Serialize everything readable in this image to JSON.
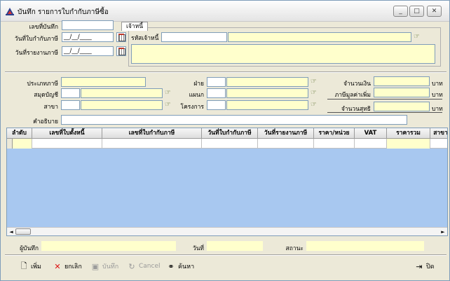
{
  "window": {
    "title": "บันทึก รายการใบกำกับภาษีซื้อ",
    "min": "_",
    "max": "□",
    "close": "✕"
  },
  "header": {
    "doc_no_label": "เลขที่บันทึก",
    "invoice_date_label": "วันที่ใบกำกับภาษี",
    "invoice_date_value": "__/__/____",
    "report_date_label": "วันที่รายงานภาษี",
    "report_date_value": "__/__/____"
  },
  "creditor": {
    "tab": "เจ้าหนี้",
    "code_label": "รหัสเจ้าหนี้"
  },
  "details": {
    "tax_type_label": "ประเภทภาษี",
    "account_book_label": "สมุดบัญชี",
    "branch_label": "สาขา",
    "division_label": "ฝ่าย",
    "department_label": "แผนก",
    "project_label": "โครงการ",
    "amount_label": "จำนวนเงิน",
    "vat_label": "ภาษีมูลค่าเพิ่ม",
    "net_label": "จำนวนสุทธิ",
    "unit": "บาท",
    "description_label": "คำอธิบาย"
  },
  "grid": {
    "columns": [
      "ลำดับ",
      "เลขที่ใบตั้งหนี้",
      "เลขที่ใบกำกับภาษี",
      "วันที่ใบกำกับภาษี",
      "วันที่รายงานภาษี",
      "ราคา/หน่วย",
      "VAT",
      "ราคารวม",
      "สาขา"
    ]
  },
  "status": {
    "recorder_label": "ผู้บันทึก",
    "date_label": "วันที่",
    "state_label": "สถานะ"
  },
  "toolbar": {
    "add": "เพิ่ม",
    "cancel_edit": "ยกเลิก",
    "save": "บันทึก",
    "cancel": "Cancel",
    "search": "ค้นหา",
    "close": "ปิด"
  },
  "colors": {
    "grid_bg": "#a8c8f0",
    "field_yellow": "#ffffcc",
    "window_bg": "#ece9d8"
  }
}
